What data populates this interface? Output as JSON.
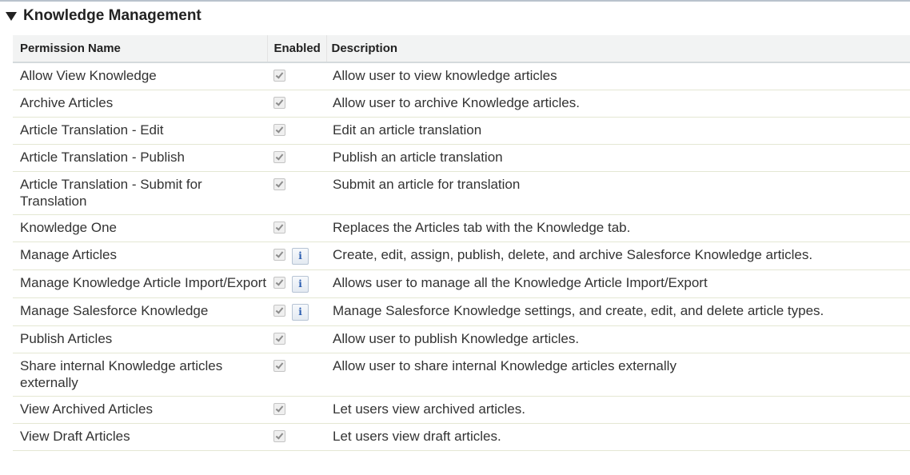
{
  "section": {
    "title": "Knowledge Management",
    "expanded": true
  },
  "table": {
    "headers": {
      "name": "Permission Name",
      "enabled": "Enabled",
      "description": "Description"
    },
    "rows": [
      {
        "name": "Allow View Knowledge",
        "enabled": true,
        "info": false,
        "description": "Allow user to view knowledge articles"
      },
      {
        "name": "Archive Articles",
        "enabled": true,
        "info": false,
        "description": "Allow user to archive Knowledge articles."
      },
      {
        "name": "Article Translation - Edit",
        "enabled": true,
        "info": false,
        "description": "Edit an article translation"
      },
      {
        "name": "Article Translation - Publish",
        "enabled": true,
        "info": false,
        "description": "Publish an article translation"
      },
      {
        "name": "Article Translation - Submit for Translation",
        "enabled": true,
        "info": false,
        "description": "Submit an article for translation"
      },
      {
        "name": "Knowledge One",
        "enabled": true,
        "info": false,
        "description": "Replaces the Articles tab with the Knowledge tab."
      },
      {
        "name": "Manage Articles",
        "enabled": true,
        "info": true,
        "description": "Create, edit, assign, publish, delete, and archive Salesforce Knowledge articles."
      },
      {
        "name": "Manage Knowledge Article Import/Export",
        "enabled": true,
        "info": true,
        "description": "Allows user to manage all the Knowledge Article Import/Export"
      },
      {
        "name": "Manage Salesforce Knowledge",
        "enabled": true,
        "info": true,
        "description": "Manage Salesforce Knowledge settings, and create, edit, and delete article types."
      },
      {
        "name": "Publish Articles",
        "enabled": true,
        "info": false,
        "description": "Allow user to publish Knowledge articles."
      },
      {
        "name": "Share internal Knowledge articles externally",
        "enabled": true,
        "info": false,
        "description": "Allow user to share internal Knowledge articles externally"
      },
      {
        "name": "View Archived Articles",
        "enabled": true,
        "info": false,
        "description": "Let users view archived articles."
      },
      {
        "name": "View Draft Articles",
        "enabled": true,
        "info": false,
        "description": "Let users view draft articles."
      }
    ]
  },
  "icons": {
    "info_glyph": "i",
    "twisty": "triangle-down-icon",
    "checkbox": "checkmark-icon"
  }
}
